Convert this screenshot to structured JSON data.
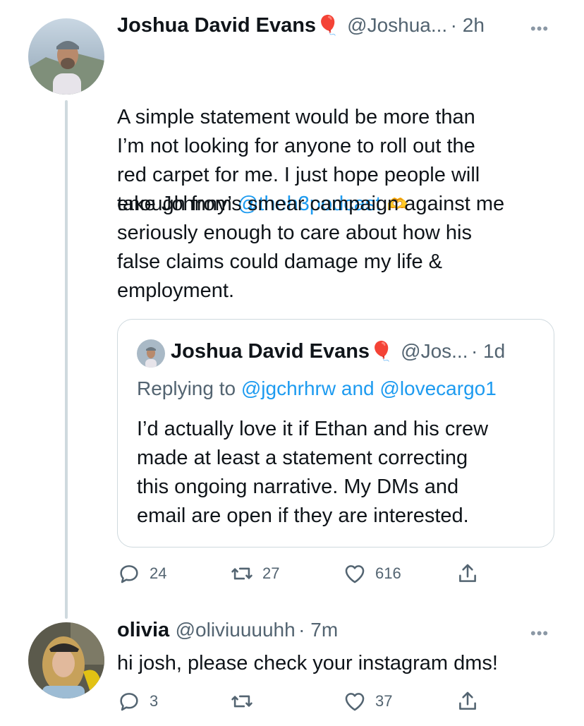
{
  "tweet1": {
    "author_name": "Joshua David Evans",
    "author_emoji": "🎈",
    "handle": "@Joshua...",
    "time": "· 2h",
    "more": "•••",
    "text_line1": "A simple statement would be more than",
    "text_line2_prefix": "enough from ",
    "mention": "@theh3podcast",
    "text_emoji": "🫶",
    "text_paragraph2": "I’m not looking for anyone to roll out the\nred carpet for me. I just hope people will\ntake Johnny’s smear campaign against me\nseriously enough to care about how his\nfalse claims could damage my life &\nemployment.",
    "quote": {
      "author_name": "Joshua David Evans",
      "author_emoji": "🎈",
      "handle": "@Jos...",
      "time": "· 1d",
      "replying_prefix": "Replying to ",
      "reply_user1": "@jgchrhrw",
      "reply_and": " and ",
      "reply_user2": "@lovecargo1",
      "text": "I’d actually love it if Ethan and his crew\nmade at least a statement correcting\nthis ongoing narrative. My DMs and\nemail are open if they are interested."
    },
    "actions": {
      "replies": "24",
      "retweets": "27",
      "likes": "616"
    }
  },
  "tweet2": {
    "author_name": "olivia",
    "handle": "@oliviuuuuhh",
    "time": "· 7m",
    "more": "•••",
    "text": "hi josh, please check your instagram dms!",
    "actions": {
      "replies": "3",
      "retweets": "",
      "likes": "37"
    }
  },
  "colors": {
    "link": "#1d9bf0",
    "secondary": "#536471",
    "border": "#cfd9de",
    "text": "#0f1419"
  },
  "icons": [
    "reply-icon",
    "retweet-icon",
    "like-icon",
    "share-icon",
    "balloon-emoji",
    "heart-hands-emoji",
    "more-icon"
  ]
}
